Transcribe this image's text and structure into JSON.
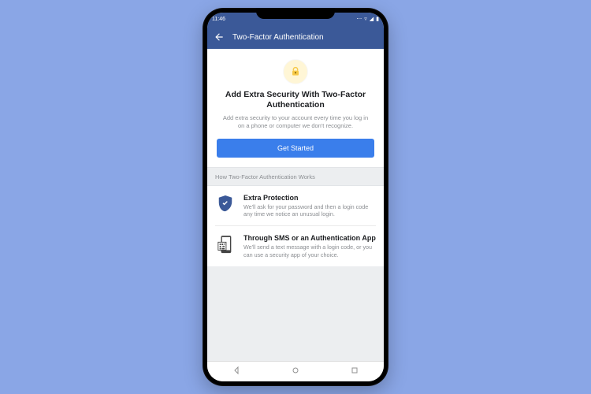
{
  "status": {
    "time": "11:46"
  },
  "appbar": {
    "title": "Two-Factor Authentication"
  },
  "hero": {
    "heading": "Add Extra Security With Two-Factor Authentication",
    "sub": "Add extra security to your account every time you log in on a phone or computer we don't recognize.",
    "cta": "Get Started"
  },
  "section_label": "How Two-Factor Authentication Works",
  "rows": {
    "0": {
      "title": "Extra Protection",
      "desc": "We'll ask for your password and then a login code any time we notice an unusual login."
    },
    "1": {
      "title": "Through SMS or an Authentication App",
      "desc": "We'll send a text message with a login code, or you can use a security app of your choice."
    }
  }
}
